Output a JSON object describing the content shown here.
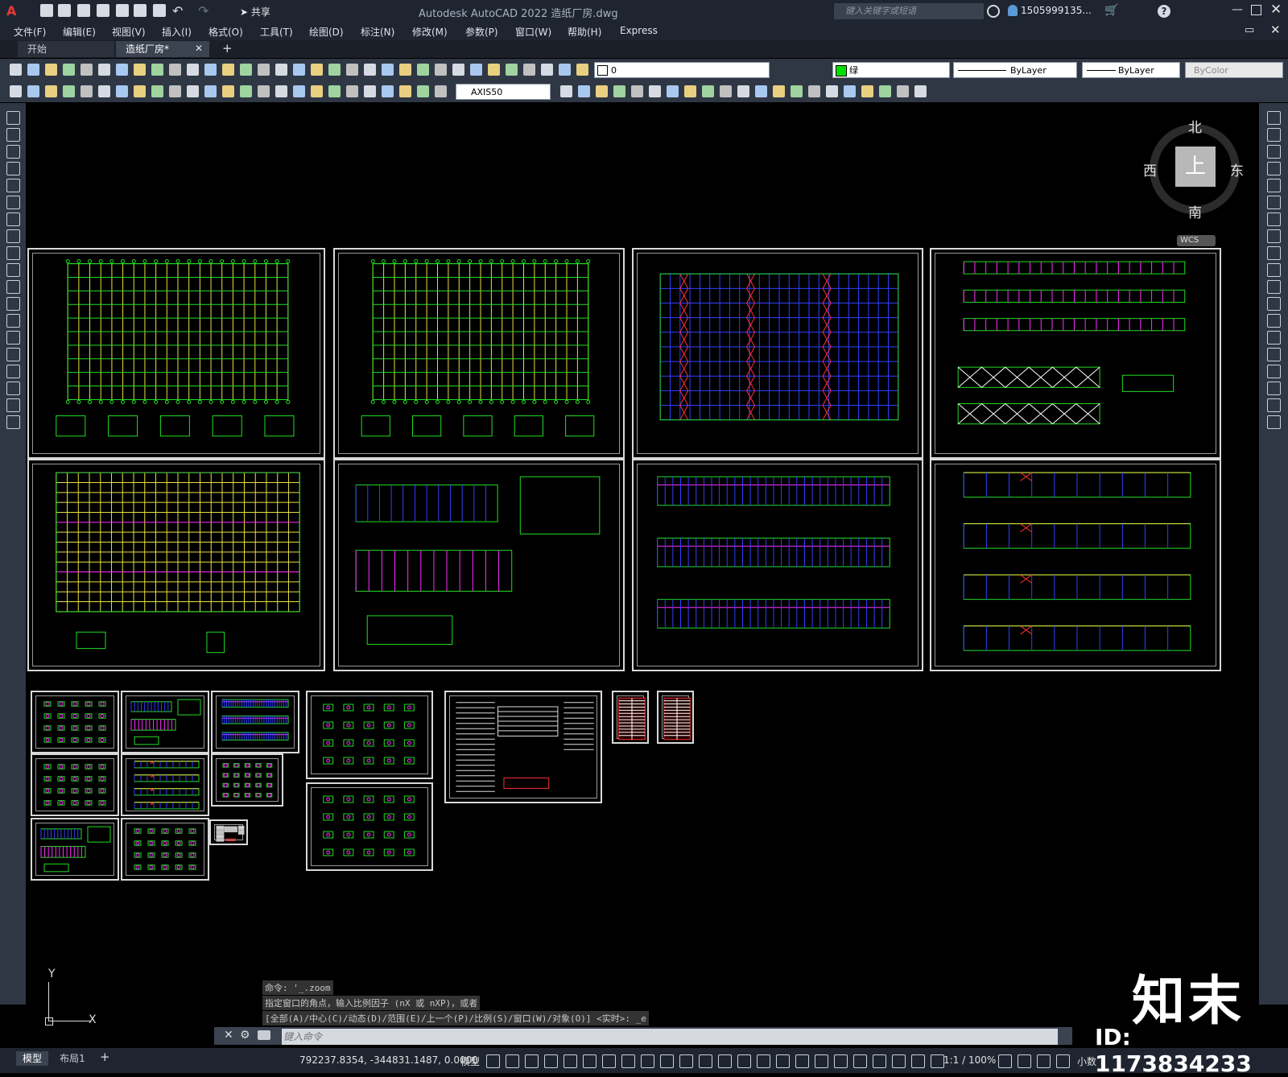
{
  "app": {
    "title": "Autodesk AutoCAD 2022    造纸厂房.dwg",
    "search_placeholder": "键入关键字或短语",
    "user": "1505999135...",
    "share": "共享"
  },
  "menu": [
    "文件(F)",
    "编辑(E)",
    "视图(V)",
    "插入(I)",
    "格式(O)",
    "工具(T)",
    "绘图(D)",
    "标注(N)",
    "修改(M)",
    "参数(P)",
    "窗口(W)",
    "帮助(H)",
    "Express"
  ],
  "tabs": [
    {
      "label": "开始",
      "active": false
    },
    {
      "label": "造纸厂房*",
      "active": true
    }
  ],
  "toolbar": {
    "layer_value": "0",
    "color_value": "绿",
    "linetype_value": "ByLayer",
    "lineweight_value": "ByLayer",
    "plotstyle_value": "ByColor",
    "dimstyle_value": "AXIS50"
  },
  "viewcube": {
    "north": "北",
    "south": "南",
    "east": "东",
    "west": "西",
    "top": "上",
    "wcs": "WCS"
  },
  "command_history": [
    "命令: '_.zoom",
    "指定窗口的角点，输入比例因子 (nX 或 nXP)，或者",
    "[全部(A)/中心(C)/动态(D)/范围(E)/上一个(P)/比例(S)/窗口(W)/对象(O)] <实时>: _e"
  ],
  "command_placeholder": "键入命令",
  "layout_tabs": [
    "模型",
    "布局1"
  ],
  "status": {
    "coords": "792237.8354, -344831.1487, 0.0000",
    "mode": "模型",
    "scale": "1:1 / 100%",
    "units": "小数"
  },
  "ucs": {
    "y": "Y",
    "x": "X"
  },
  "watermark": {
    "logo": "知末",
    "id": "ID: 1173834233"
  },
  "colors": {
    "drawing_green": "#22dd22",
    "drawing_yellow": "#e8e040",
    "drawing_blue": "#3040ff",
    "drawing_magenta": "#ff30ff",
    "drawing_red": "#ff3030",
    "background": "#000000"
  }
}
